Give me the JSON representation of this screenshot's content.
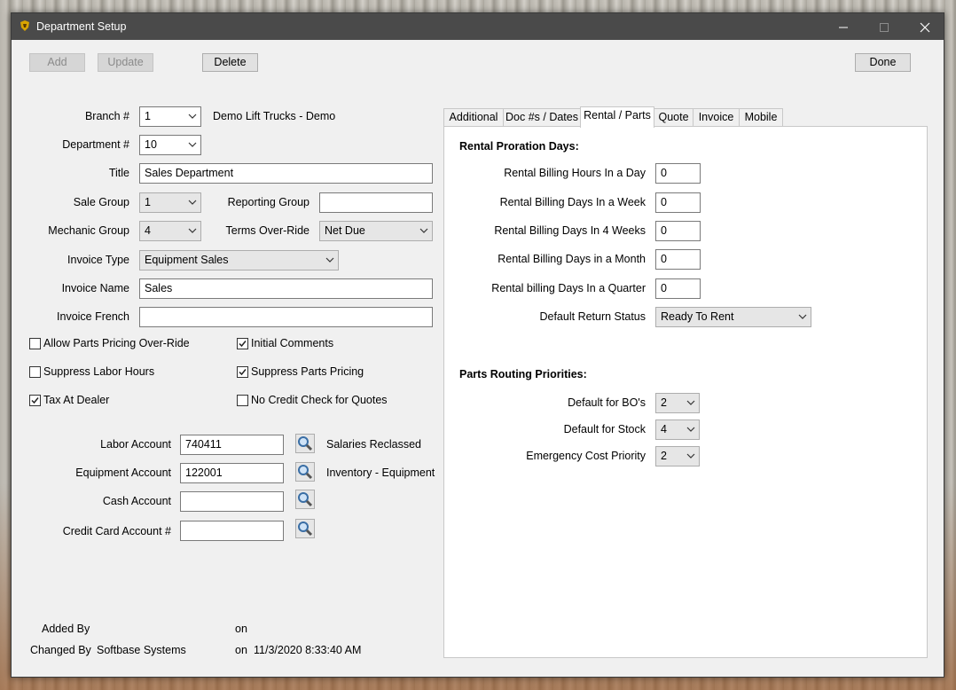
{
  "window": {
    "title": "Department Setup"
  },
  "toolbar": {
    "add": "Add",
    "update": "Update",
    "delete": "Delete",
    "done": "Done"
  },
  "form": {
    "branch_label": "Branch #",
    "branch_value": "1",
    "branch_name": "Demo Lift Trucks - Demo",
    "department_label": "Department #",
    "department_value": "10",
    "title_label": "Title",
    "title_value": "Sales Department",
    "sale_group_label": "Sale Group",
    "sale_group_value": "1",
    "reporting_group_label": "Reporting Group",
    "reporting_group_value": "",
    "mechanic_group_label": "Mechanic Group",
    "mechanic_group_value": "4",
    "terms_label": "Terms Over-Ride",
    "terms_value": "Net Due",
    "invoice_type_label": "Invoice Type",
    "invoice_type_value": "Equipment Sales",
    "invoice_name_label": "Invoice Name",
    "invoice_name_value": "Sales",
    "invoice_french_label": "Invoice French",
    "invoice_french_value": ""
  },
  "checkboxes": {
    "allow_parts_pricing": {
      "label": "Allow Parts Pricing Over-Ride",
      "checked": false
    },
    "initial_comments": {
      "label": "Initial Comments",
      "checked": true
    },
    "suppress_labor_hours": {
      "label": "Suppress Labor Hours",
      "checked": false
    },
    "suppress_parts_pricing": {
      "label": "Suppress Parts Pricing",
      "checked": true
    },
    "tax_at_dealer": {
      "label": "Tax At Dealer",
      "checked": true
    },
    "no_credit_check": {
      "label": "No Credit Check for Quotes",
      "checked": false
    }
  },
  "accounts": {
    "labor_label": "Labor Account",
    "labor_value": "740411",
    "labor_desc": "Salaries Reclassed",
    "equipment_label": "Equipment Account",
    "equipment_value": "122001",
    "equipment_desc": "Inventory - Equipment",
    "cash_label": "Cash Account",
    "cash_value": "",
    "credit_label": "Credit Card Account #",
    "credit_value": ""
  },
  "audit": {
    "added_by_label": "Added By",
    "added_by_value": "",
    "added_on_label": "on",
    "added_on_value": "",
    "changed_by_label": "Changed By",
    "changed_by_value": "Softbase Systems",
    "changed_on_label": "on",
    "changed_on_value": "11/3/2020 8:33:40 AM"
  },
  "tabs": [
    {
      "label": "Additional"
    },
    {
      "label": "Doc #s / Dates"
    },
    {
      "label": "Rental / Parts"
    },
    {
      "label": "Quote"
    },
    {
      "label": "Invoice"
    },
    {
      "label": "Mobile"
    }
  ],
  "rental": {
    "section_title": "Rental Proration Days:",
    "hours_day_label": "Rental Billing Hours In a Day",
    "hours_day_value": "0",
    "days_week_label": "Rental Billing Days In a Week",
    "days_week_value": "0",
    "days_4weeks_label": "Rental Billing Days In 4 Weeks",
    "days_4weeks_value": "0",
    "days_month_label": "Rental Billing Days in a Month",
    "days_month_value": "0",
    "days_quarter_label": "Rental billing Days In a Quarter",
    "days_quarter_value": "0",
    "return_status_label": "Default Return Status",
    "return_status_value": "Ready To Rent"
  },
  "parts": {
    "section_title": "Parts Routing Priorities:",
    "bo_label": "Default for BO's",
    "bo_value": "2",
    "stock_label": "Default for Stock",
    "stock_value": "4",
    "emergency_label": "Emergency Cost Priority",
    "emergency_value": "2"
  },
  "colors": {
    "titlebar": "#4a4a4a",
    "window_bg": "#f0f0f0",
    "panel_bg": "#ffffff"
  }
}
